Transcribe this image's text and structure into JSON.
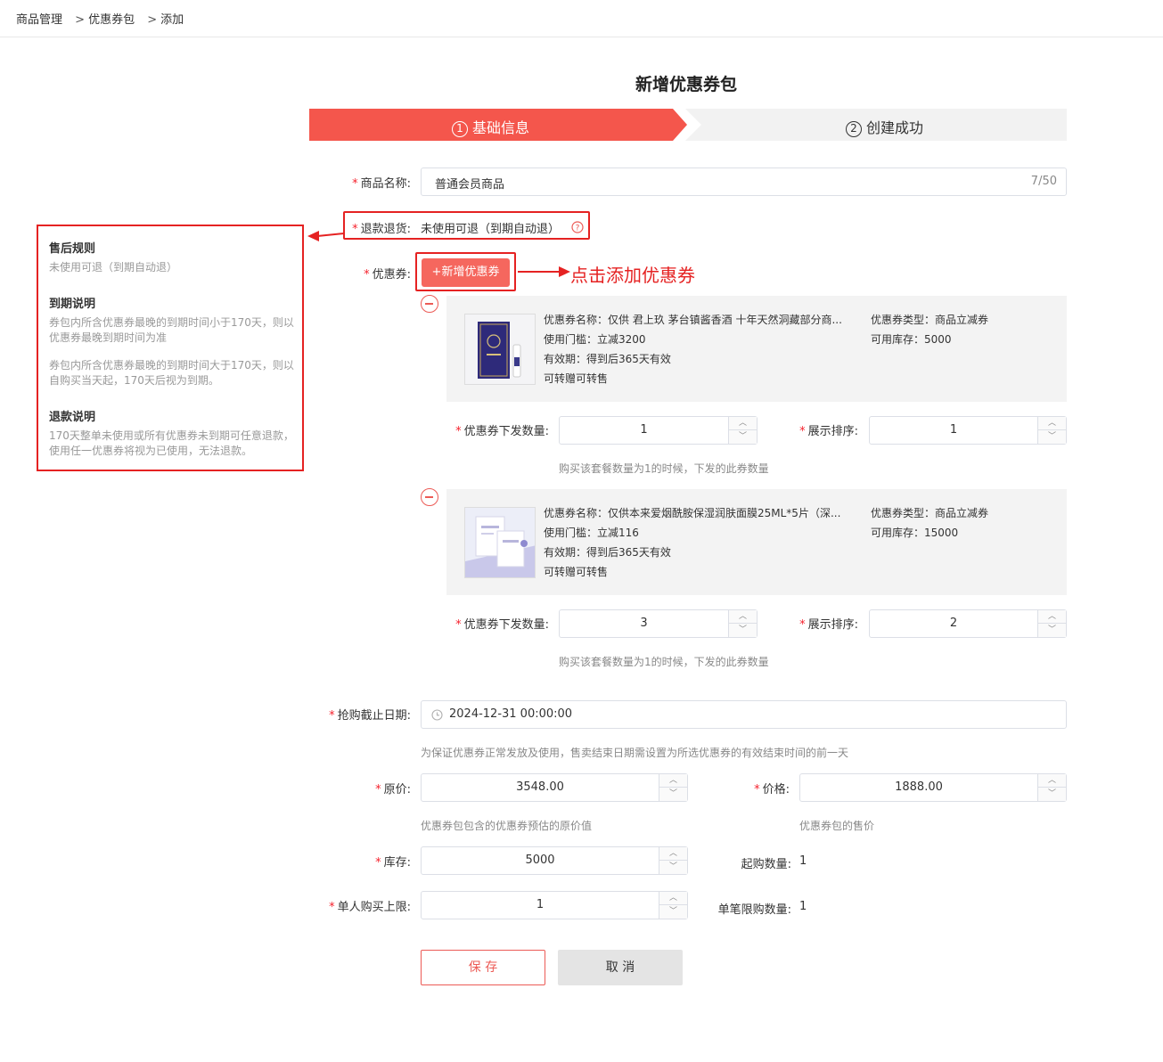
{
  "breadcrumb": {
    "item1": "商品管理",
    "sep": ">",
    "item2": "优惠券包",
    "item3": "添加"
  },
  "title": "新增优惠券包",
  "steps": [
    {
      "num": "1",
      "label": "基础信息"
    },
    {
      "num": "2",
      "label": "创建成功"
    }
  ],
  "form": {
    "name_label": "商品名称:",
    "name_value": "普通会员商品",
    "name_counter": "7/50",
    "refund_label": "退款退货:",
    "refund_value": "未使用可退（到期自动退）",
    "coupon_label": "优惠券:",
    "add_coupon_button": "+新增优惠券",
    "deadline_label": "抢购截止日期:",
    "deadline_value": "2024-12-31 00:00:00",
    "deadline_hint": "为保证优惠券正常发放及使用，售卖结束日期需设置为所选优惠券的有效结束时间的前一天",
    "original_price_label": "原价:",
    "original_price_value": "3548.00",
    "original_price_hint": "优惠券包包含的优惠券预估的原价值",
    "price_label": "价格:",
    "price_value": "1888.00",
    "price_hint": "优惠券包的售价",
    "stock_label": "库存:",
    "stock_value": "5000",
    "min_buy_label": "起购数量:",
    "min_buy_value": "1",
    "limit_label": "单人购买上限:",
    "limit_value": "1",
    "per_order_label": "单笔限购数量:",
    "per_order_value": "1"
  },
  "coupons": [
    {
      "name": "优惠券名称：仅供 君上玖 茅台镇酱香酒 十年天然洞藏部分商...",
      "threshold": "使用门槛：立减3200",
      "validity": "有效期：得到后365天有效",
      "transfer": "可转赠可转售",
      "type": "优惠券类型：商品立减券",
      "stock": "可用库存：5000",
      "qty_label": "优惠券下发数量:",
      "qty_value": "1",
      "sort_label": "展示排序:",
      "sort_value": "1",
      "hint": "购买该套餐数量为1的时候，下发的此券数量"
    },
    {
      "name": "优惠券名称：仅供本来爱烟酰胺保湿润肤面膜25ML*5片（深...",
      "threshold": "使用门槛：立减116",
      "validity": "有效期：得到后365天有效",
      "transfer": "可转赠可转售",
      "type": "优惠券类型：商品立减券",
      "stock": "可用库存：15000",
      "qty_label": "优惠券下发数量:",
      "qty_value": "3",
      "sort_label": "展示排序:",
      "sort_value": "2",
      "hint": "购买该套餐数量为1的时候，下发的此券数量"
    }
  ],
  "sidebar": {
    "after_sale_title": "售后规则",
    "after_sale_text": "未使用可退（到期自动退）",
    "expiry_title": "到期说明",
    "expiry_text1": "券包内所含优惠券最晚的到期时间小于170天，则以优惠券最晚到期时间为准",
    "expiry_text2": "券包内所含优惠券最晚的到期时间大于170天，则以自购买当天起，170天后视为到期。",
    "refund_title": "退款说明",
    "refund_text": "170天整单未使用或所有优惠券未到期可任意退款，使用任一优惠券将视为已使用，无法退款。"
  },
  "annotation": "点击添加优惠券",
  "buttons": {
    "save": "保 存",
    "cancel": "取 消"
  },
  "colors": {
    "accent": "#ec5b56",
    "highlight": "#e52222",
    "step_inactive": "#f2f2f2"
  }
}
